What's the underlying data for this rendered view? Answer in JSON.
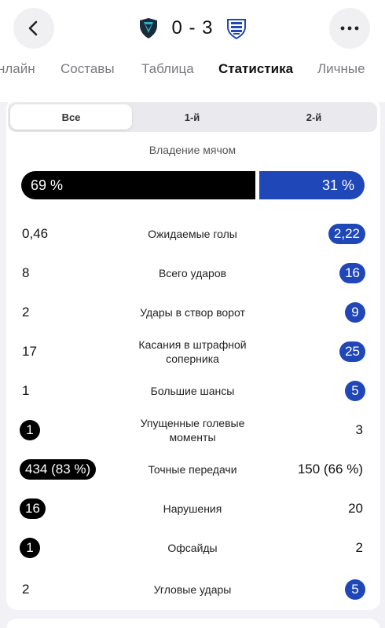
{
  "header": {
    "score": "0 - 3",
    "home_logo_icon": "team-crest-icon",
    "away_logo_icon": "team-crest-icon"
  },
  "tabs": [
    {
      "label": "нлайн",
      "active": false
    },
    {
      "label": "Составы",
      "active": false
    },
    {
      "label": "Таблица",
      "active": false
    },
    {
      "label": "Статистика",
      "active": true
    },
    {
      "label": "Личные",
      "active": false
    }
  ],
  "segments": [
    {
      "label": "Все",
      "active": true
    },
    {
      "label": "1-й",
      "active": false
    },
    {
      "label": "2-й",
      "active": false
    }
  ],
  "possession": {
    "title": "Владение мячом",
    "home": "69 %",
    "away": "31 %",
    "home_fraction": 0.69
  },
  "stats": [
    {
      "label": "Ожидаемые голы",
      "home": "0,46",
      "away": "2,22",
      "highlight": "away"
    },
    {
      "label": "Всего ударов",
      "home": "8",
      "away": "16",
      "highlight": "away"
    },
    {
      "label": "Удары в створ ворот",
      "home": "2",
      "away": "9",
      "highlight": "away"
    },
    {
      "label": "Касания в штрафной соперника",
      "home": "17",
      "away": "25",
      "highlight": "away"
    },
    {
      "label": "Большие шансы",
      "home": "1",
      "away": "5",
      "highlight": "away"
    },
    {
      "label": "Упущенные голевые моменты",
      "home": "1",
      "away": "3",
      "highlight": "home"
    },
    {
      "label": "Точные передачи",
      "home": "434 (83 %)",
      "away": "150 (66 %)",
      "highlight": "home"
    },
    {
      "label": "Нарушения",
      "home": "16",
      "away": "20",
      "highlight": "home"
    },
    {
      "label": "Офсайды",
      "home": "1",
      "away": "2",
      "highlight": "home"
    },
    {
      "label": "Угловые удары",
      "home": "2",
      "away": "5",
      "highlight": "away"
    }
  ],
  "colors": {
    "home_accent": "#000000",
    "away_accent": "#1f47b8"
  }
}
